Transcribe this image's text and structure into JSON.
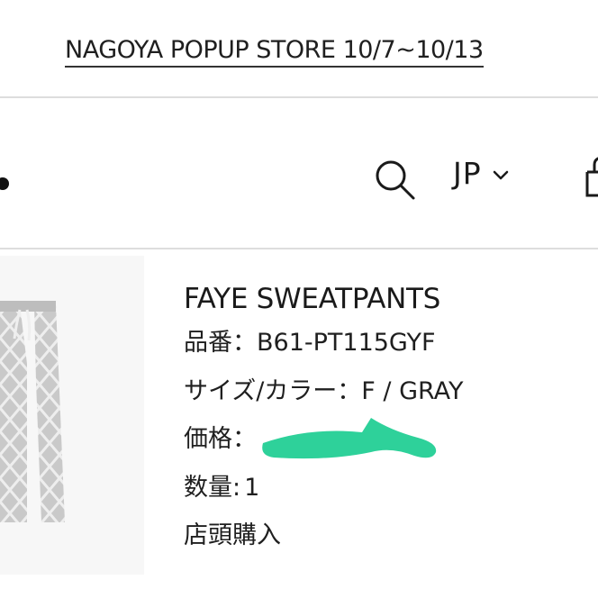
{
  "announcement": {
    "text": "NAGOYA POPUP STORE 10/7~10/13"
  },
  "header": {
    "locale_label": "JP",
    "icons": {
      "search": "search-icon",
      "locale_dropdown": "chevron-down-icon",
      "cart": "shopping-bag-icon"
    }
  },
  "product": {
    "name": "FAYE SWEATPANTS",
    "item_number_label": "品番：",
    "item_number": "B61-PT115GYF",
    "size_color_label": "サイズ/カラー：",
    "size_color": "F / GRAY",
    "price_label": "価格：",
    "quantity_label": "数量:",
    "quantity": "1",
    "purchase_type": "店頭購入"
  },
  "colors": {
    "redaction": "#2ed19a",
    "divider": "#dddddd",
    "thumb_background": "#f7f7f7"
  }
}
